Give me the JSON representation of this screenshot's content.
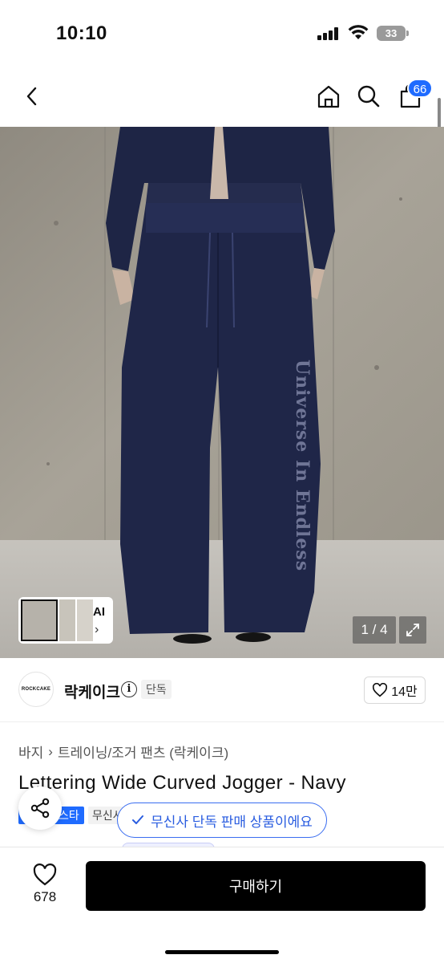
{
  "status_bar": {
    "time": "10:10",
    "battery": "33"
  },
  "nav": {
    "cart_count": "66"
  },
  "gallery": {
    "counter": "1 / 4",
    "ai_label": "AI",
    "print_text": "Universe In Endless"
  },
  "brand": {
    "logo_text": "ROCKCAKE",
    "name": "락케이크",
    "exclusive": "단독",
    "likes": "14만"
  },
  "breadcrumb": [
    "바지",
    "트레이닝/조거 팬츠 (락케이크)"
  ],
  "product": {
    "title": "Lettering Wide Curved Jogger - Navy"
  },
  "tags": {
    "blue_tag": "스타",
    "gray_tag": "무신사"
  },
  "tooltip": {
    "text": "무신사 단독 판매 상품이에요"
  },
  "bottom_bar": {
    "wish_count": "678",
    "buy_label": "구매하기"
  },
  "colors": {
    "accent": "#1f6bff",
    "buy_button": "#000000",
    "pants": "#1f2648",
    "wall": "#9c978d"
  }
}
